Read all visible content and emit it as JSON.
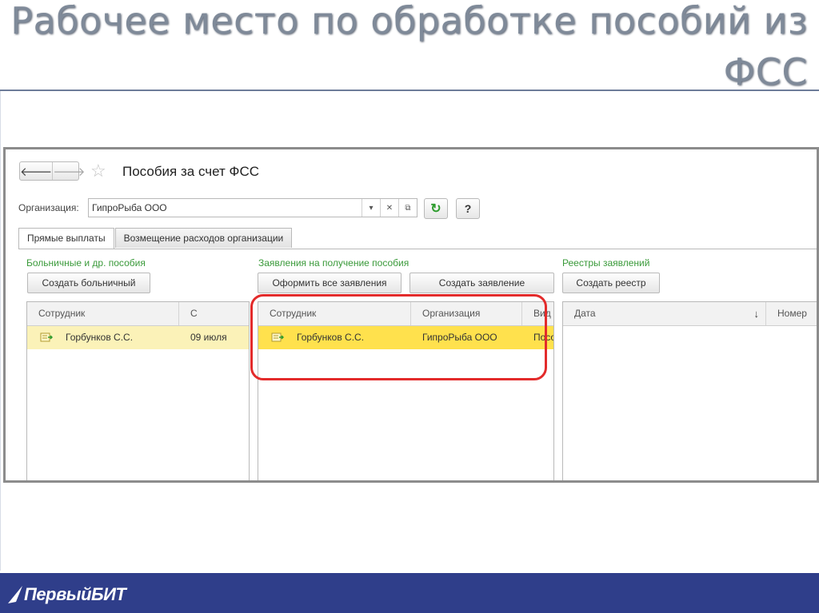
{
  "slide": {
    "title": "Рабочее место по обработке пособий из ФСС",
    "logo_text": "ПервыйБИТ"
  },
  "window": {
    "title": "Пособия за счет ФСС"
  },
  "organization": {
    "label": "Организация:",
    "value": "ГипроРыба ООО"
  },
  "tabs": [
    {
      "label": "Прямые выплаты",
      "active": true
    },
    {
      "label": "Возмещение расходов организации",
      "active": false
    }
  ],
  "sections": {
    "sick": {
      "label": "Больничные и др. пособия",
      "button": "Создать больничный",
      "columns": [
        "Сотрудник",
        "С"
      ],
      "rows": [
        {
          "employee": "Горбунков С.С.",
          "from": "09 июля"
        }
      ]
    },
    "applications": {
      "label": "Заявления на получение пособия",
      "button_process_all": "Оформить все заявления",
      "button_create": "Создать заявление",
      "columns": [
        "Сотрудник",
        "Организация",
        "Вид"
      ],
      "rows": [
        {
          "employee": "Горбунков С.С.",
          "organization": "ГипроРыба ООО",
          "kind": "Посо"
        }
      ]
    },
    "registers": {
      "label": "Реестры заявлений",
      "button": "Создать реестр",
      "columns": [
        "Дата",
        "Номер"
      ]
    }
  },
  "colors": {
    "row_selected": "#ffe14d",
    "row_inactive": "#fbf2b8",
    "group_label": "#3a9a3a",
    "highlight": "#e32b2b",
    "footer": "#2f3e8a"
  }
}
